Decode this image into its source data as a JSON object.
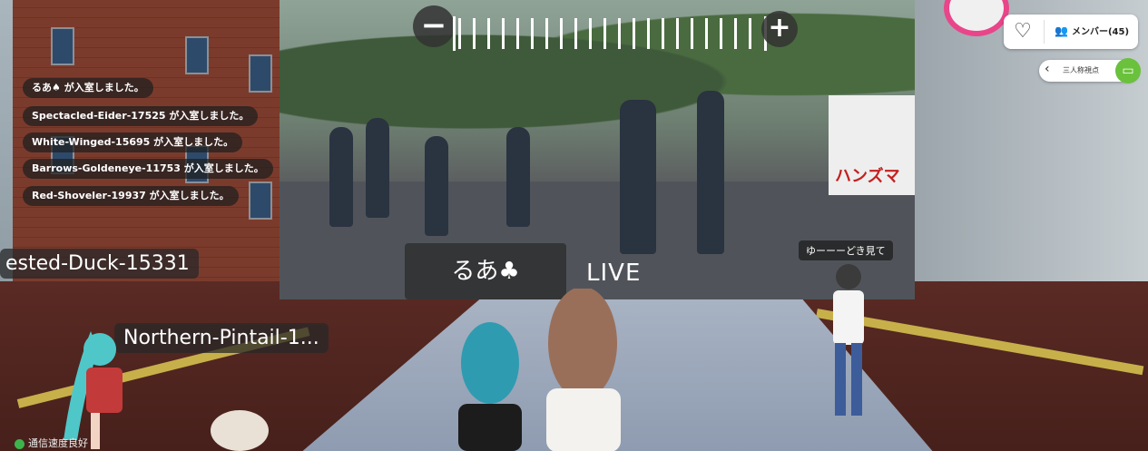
{
  "chat": {
    "messages": [
      "るあ♠ が入室しました。",
      "Spectacled-Eider-17525 が入室しました。",
      "White-Winged-15695 が入室しました。",
      "Barrows-Goldeneye-11753 が入室しました。",
      "Red-Shoveler-19937 が入室しました。"
    ]
  },
  "name_tags": {
    "left_partial": "ested-Duck-15331",
    "northern": "Northern-Pintail-1..."
  },
  "stream": {
    "caption": "るあ♣",
    "live_label": "LIVE",
    "corner_caption": "ゆーーーどき見て",
    "banner_text": "ハンズマ",
    "zoom_minus": "−",
    "zoom_plus": "+"
  },
  "header": {
    "members_label": "メンバー(45)",
    "view_label": "三人称視点"
  },
  "status": {
    "label": "通信速度良好"
  }
}
